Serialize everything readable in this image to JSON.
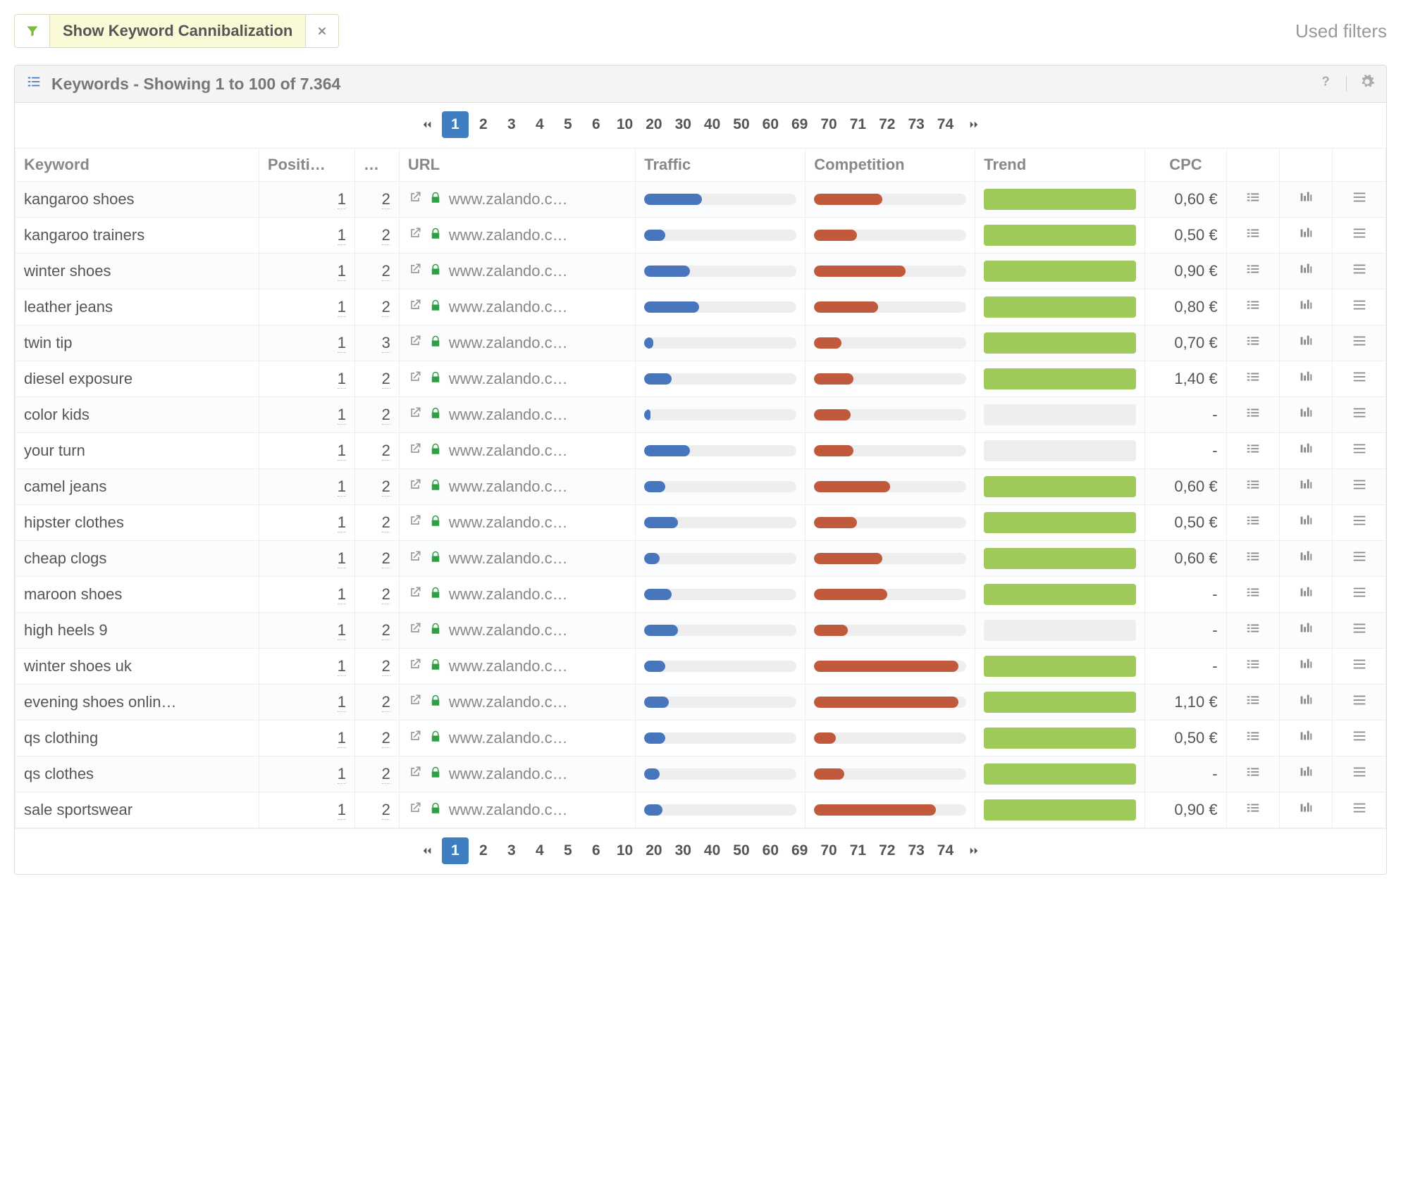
{
  "top": {
    "filter_chip_label": "Show Keyword Cannibalization",
    "used_filters": "Used filters"
  },
  "panel": {
    "title": "Keywords - Showing 1 to 100 of 7.364"
  },
  "columns": {
    "keyword": "Keyword",
    "position": "Positi…",
    "dotcol": "…",
    "url": "URL",
    "traffic": "Traffic",
    "competition": "Competition",
    "trend": "Trend",
    "cpc": "CPC"
  },
  "pages": [
    "1",
    "2",
    "3",
    "4",
    "5",
    "6",
    "10",
    "20",
    "30",
    "40",
    "50",
    "60",
    "69",
    "70",
    "71",
    "72",
    "73",
    "74"
  ],
  "rows": [
    {
      "k": "kangaroo shoes",
      "p": "1",
      "d": "2",
      "u": "www.zalando.c…",
      "t": 38,
      "c": 45,
      "trend": true,
      "cpc": "0,60 €"
    },
    {
      "k": "kangaroo trainers",
      "p": "1",
      "d": "2",
      "u": "www.zalando.c…",
      "t": 14,
      "c": 28,
      "trend": true,
      "cpc": "0,50 €"
    },
    {
      "k": "winter shoes",
      "p": "1",
      "d": "2",
      "u": "www.zalando.c…",
      "t": 30,
      "c": 60,
      "trend": true,
      "cpc": "0,90 €"
    },
    {
      "k": "leather jeans",
      "p": "1",
      "d": "2",
      "u": "www.zalando.c…",
      "t": 36,
      "c": 42,
      "trend": true,
      "cpc": "0,80 €"
    },
    {
      "k": "twin tip",
      "p": "1",
      "d": "3",
      "u": "www.zalando.c…",
      "t": 6,
      "c": 18,
      "trend": true,
      "cpc": "0,70 €"
    },
    {
      "k": "diesel exposure",
      "p": "1",
      "d": "2",
      "u": "www.zalando.c…",
      "t": 18,
      "c": 26,
      "trend": true,
      "cpc": "1,40 €"
    },
    {
      "k": "color kids",
      "p": "1",
      "d": "2",
      "u": "www.zalando.c…",
      "t": 4,
      "c": 24,
      "trend": false,
      "cpc": "-"
    },
    {
      "k": "your turn",
      "p": "1",
      "d": "2",
      "u": "www.zalando.c…",
      "t": 30,
      "c": 26,
      "trend": false,
      "cpc": "-"
    },
    {
      "k": "camel jeans",
      "p": "1",
      "d": "2",
      "u": "www.zalando.c…",
      "t": 14,
      "c": 50,
      "trend": true,
      "cpc": "0,60 €"
    },
    {
      "k": "hipster clothes",
      "p": "1",
      "d": "2",
      "u": "www.zalando.c…",
      "t": 22,
      "c": 28,
      "trend": true,
      "cpc": "0,50 €"
    },
    {
      "k": "cheap clogs",
      "p": "1",
      "d": "2",
      "u": "www.zalando.c…",
      "t": 10,
      "c": 45,
      "trend": true,
      "cpc": "0,60 €"
    },
    {
      "k": "maroon shoes",
      "p": "1",
      "d": "2",
      "u": "www.zalando.c…",
      "t": 18,
      "c": 48,
      "trend": true,
      "cpc": "-"
    },
    {
      "k": "high heels 9",
      "p": "1",
      "d": "2",
      "u": "www.zalando.c…",
      "t": 22,
      "c": 22,
      "trend": false,
      "cpc": "-"
    },
    {
      "k": "winter shoes uk",
      "p": "1",
      "d": "2",
      "u": "www.zalando.c…",
      "t": 14,
      "c": 95,
      "trend": true,
      "cpc": "-"
    },
    {
      "k": "evening shoes onlin…",
      "p": "1",
      "d": "2",
      "u": "www.zalando.c…",
      "t": 16,
      "c": 95,
      "trend": true,
      "cpc": "1,10 €"
    },
    {
      "k": "qs clothing",
      "p": "1",
      "d": "2",
      "u": "www.zalando.c…",
      "t": 14,
      "c": 14,
      "trend": true,
      "cpc": "0,50 €"
    },
    {
      "k": "qs clothes",
      "p": "1",
      "d": "2",
      "u": "www.zalando.c…",
      "t": 10,
      "c": 20,
      "trend": true,
      "cpc": "-"
    },
    {
      "k": "sale sportswear",
      "p": "1",
      "d": "2",
      "u": "www.zalando.c…",
      "t": 12,
      "c": 80,
      "trend": true,
      "cpc": "0,90 €"
    }
  ]
}
